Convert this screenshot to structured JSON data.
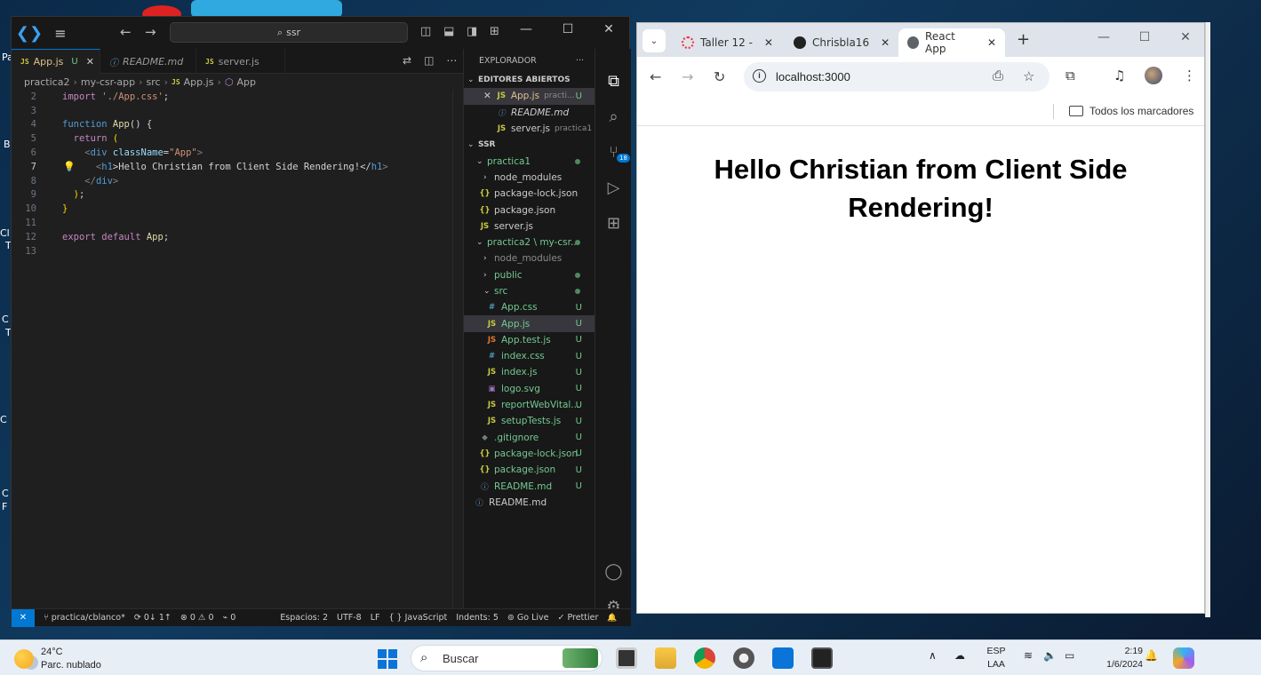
{
  "desktop": {
    "labels": [
      "Pa",
      "B",
      "Cl",
      "T",
      "C",
      "T",
      "C",
      "C",
      "F"
    ]
  },
  "vscode": {
    "search_placeholder": "ssr",
    "tabs": [
      {
        "icon": "JS",
        "label": "App.js",
        "modified": "U",
        "close": "✕"
      },
      {
        "icon": "ⓘ",
        "label": "README.md"
      },
      {
        "icon": "JS",
        "label": "server.js"
      }
    ],
    "breadcrumb": [
      "practica2",
      "my-csr-app",
      "src",
      "App.js",
      "App"
    ],
    "code_lines": [
      {
        "n": "2"
      },
      {
        "n": "3"
      },
      {
        "n": "4"
      },
      {
        "n": "5"
      },
      {
        "n": "6"
      },
      {
        "n": "7"
      },
      {
        "n": "8"
      },
      {
        "n": "9"
      },
      {
        "n": "10"
      },
      {
        "n": "11"
      },
      {
        "n": "12"
      },
      {
        "n": "13"
      }
    ],
    "code": {
      "l2a": "import",
      "l2b": " './App.css'",
      "l2c": ";",
      "l4a": "function",
      "l4b": " App",
      "l4c": "() {",
      "l5a": "  return",
      "l5b": " (",
      "l6a": "    <",
      "l6b": "div",
      "l6c": " className",
      "l6d": "=",
      "l6e": "\"App\"",
      "l6f": ">",
      "l7a": "      <",
      "l7b": "h1",
      "l7c": ">Hello Christian from Client Side Rendering!</",
      "l7d": "h1",
      "l7e": ">",
      "l8a": "    </",
      "l8b": "div",
      "l8c": ">",
      "l9a": "  )",
      "l9b": ";",
      "l10": "}",
      "l12a": "export",
      "l12b": " default",
      "l12c": " App",
      "l12d": ";"
    },
    "explorer": {
      "title": "EXPLORADOR",
      "menu": "···",
      "open_editors_title": "EDITORES ABIERTOS",
      "open_editors": [
        {
          "icon": "JS",
          "label": "App.js",
          "desc": "practi...",
          "badge": "U"
        },
        {
          "icon": "ⓘ",
          "label": "README.md"
        },
        {
          "icon": "JS",
          "label": "server.js",
          "desc": "practica1"
        }
      ],
      "workspace_title": "SSR",
      "tree": [
        {
          "label": "practica1"
        },
        {
          "label": "node_modules"
        },
        {
          "icon": "{}",
          "label": "package-lock.json"
        },
        {
          "icon": "{}",
          "label": "package.json"
        },
        {
          "icon": "JS",
          "label": "server.js"
        },
        {
          "label": "practica2 \\ my-csr..."
        },
        {
          "label": "node_modules"
        },
        {
          "label": "public"
        },
        {
          "label": "src"
        },
        {
          "icon": "#",
          "label": "App.css",
          "badge": "U"
        },
        {
          "icon": "JS",
          "label": "App.js",
          "badge": "U"
        },
        {
          "icon": "JS",
          "label": "App.test.js",
          "badge": "U"
        },
        {
          "icon": "#",
          "label": "index.css",
          "badge": "U"
        },
        {
          "icon": "JS",
          "label": "index.js",
          "badge": "U"
        },
        {
          "icon": "▣",
          "label": "logo.svg",
          "badge": "U"
        },
        {
          "icon": "JS",
          "label": "reportWebVital...",
          "badge": "U"
        },
        {
          "icon": "JS",
          "label": "setupTests.js",
          "badge": "U"
        },
        {
          "icon": "◆",
          "label": ".gitignore",
          "badge": "U"
        },
        {
          "icon": "{}",
          "label": "package-lock.json",
          "badge": "U"
        },
        {
          "icon": "{}",
          "label": "package.json",
          "badge": "U"
        },
        {
          "icon": "ⓘ",
          "label": "README.md",
          "badge": "U"
        },
        {
          "icon": "ⓘ",
          "label": "README.md"
        }
      ]
    },
    "activity_badge": "18",
    "status": {
      "remote": "✕",
      "branch": "practica/cblanco*",
      "sync": "0↓ 1↑",
      "problems": "⊗ 0 ⚠ 0",
      "ports": "⌁ 0",
      "spaces": "Espacios: 2",
      "encoding": "UTF-8",
      "eol": "LF",
      "language": "{ } JavaScript",
      "indents": "Indents: 5",
      "golive": "⊚ Go Live",
      "prettier": "✓ Prettier",
      "bell": "🔔"
    }
  },
  "chrome": {
    "tabs": [
      {
        "label": "Taller 12 -",
        "active": false,
        "color": "#e33"
      },
      {
        "label": "Chrisbla16",
        "active": false,
        "color": "#222"
      },
      {
        "label": "React App",
        "active": true,
        "color": "#5f6368"
      }
    ],
    "new_tab": "+",
    "url": "localhost:3000",
    "bookmarks_all": "Todos los marcadores",
    "page_heading": "Hello Christian from Client Side Rendering!"
  },
  "taskbar": {
    "temperature": "24°C",
    "weather": "Parc. nublado",
    "search_placeholder": "Buscar",
    "lang_1": "ESP",
    "lang_2": "LAA",
    "time": "2:19",
    "date": "1/6/2024"
  }
}
